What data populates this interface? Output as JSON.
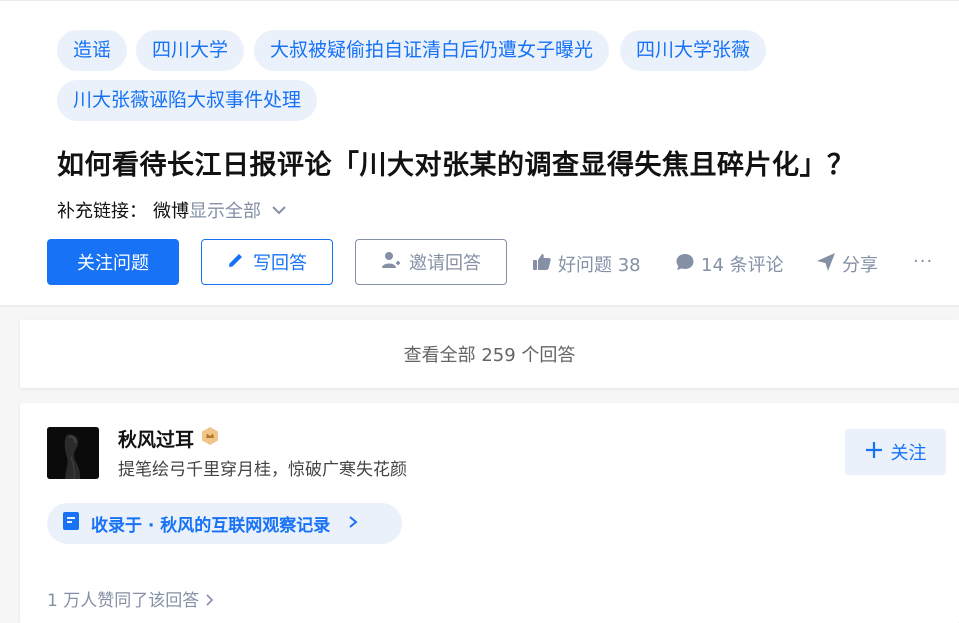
{
  "tags": [
    {
      "label": "造谣"
    },
    {
      "label": "四川大学"
    },
    {
      "label": "大叔被疑偷拍自证清白后仍遭女子曝光"
    },
    {
      "label": "四川大学张薇"
    },
    {
      "label": "川大张薇诬陷大叔事件处理"
    }
  ],
  "question": {
    "title": "如何看待长江日报评论「川大对张某的调查显得失焦且碎片化」？",
    "supplement_label": "补充链接：",
    "supplement_link": "微博",
    "show_all": "显示全部",
    "show_all_icon": "chevron-down-icon"
  },
  "actions": {
    "follow_question": "关注问题",
    "write_answer": "写回答",
    "invite_answer": "邀请回答",
    "good_question": "好问题 38",
    "comments": "14 条评论",
    "share": "分享",
    "more": "···"
  },
  "view_all": "查看全部 259 个回答",
  "answer": {
    "author_name": "秋风过耳",
    "author_bio": "提笔绘弓千里穿月桂，惊破广寒失花颜",
    "follow_label": "关注",
    "collection_label": "收录于 · 秋风的互联网观察记录",
    "likes_text": "1 万人赞同了该回答",
    "badge_icon": "badge-icon"
  },
  "colors": {
    "accent": "#1772f6",
    "tag_bg": "#eaf1fb",
    "muted": "#8590a6"
  }
}
